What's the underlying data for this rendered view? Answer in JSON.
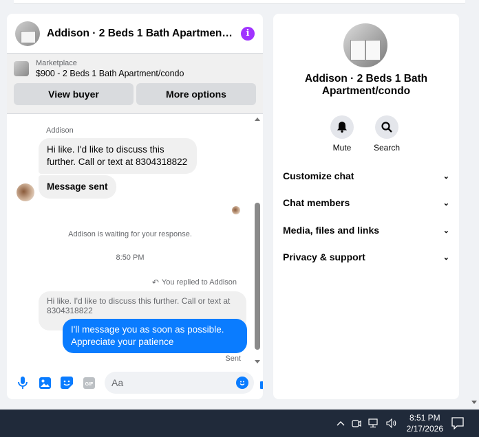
{
  "chat": {
    "title": "Addison · 2 Beds 1 Bath Apartment/condo",
    "marketplace_label": "Marketplace",
    "listing": "$900 - 2 Beds 1 Bath Apartment/condo",
    "view_buyer": "View buyer",
    "more_options": "More options",
    "sender_name": "Addison",
    "message_1": "Hi like. I'd like to discuss this further. Call or text at 8304318822",
    "message_2": "Message sent",
    "waiting": "Addison is waiting for your response.",
    "timestamp": "8:50 PM",
    "replied_to": "You replied to Addison",
    "quoted": "Hi like. I'd like to discuss this further. Call or text at 8304318822",
    "my_reply": "I'll message you as soon as possible. Appreciate your patience",
    "status": "Sent",
    "composer_placeholder": "Aa",
    "gif_label": "GIF"
  },
  "info": {
    "name": "Addison · 2 Beds 1 Bath Apartment/condo",
    "actions": [
      {
        "label": "Mute",
        "icon": "bell-icon"
      },
      {
        "label": "Search",
        "icon": "search-icon"
      }
    ],
    "menu": [
      {
        "label": "Customize chat"
      },
      {
        "label": "Chat members"
      },
      {
        "label": "Media, files and links"
      },
      {
        "label": "Privacy & support"
      }
    ]
  },
  "taskbar": {
    "time": "8:51 PM",
    "date": "2/17/2026"
  },
  "colors": {
    "accent": "#0a7cff",
    "info_purple": "#a033ff",
    "taskbar": "#202a3a"
  }
}
